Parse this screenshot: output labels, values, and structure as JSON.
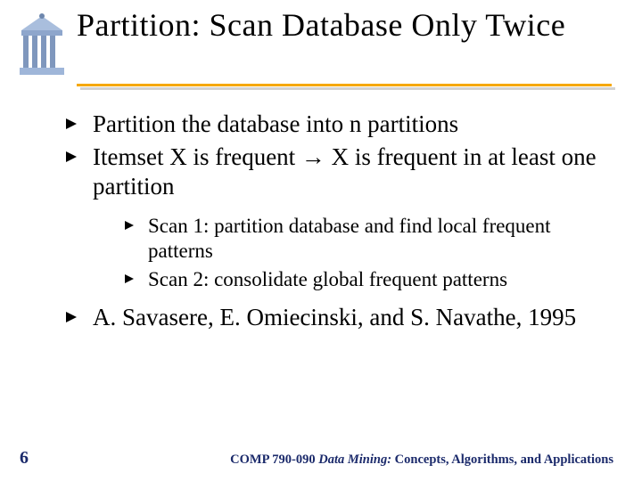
{
  "title": "Partition: Scan Database Only Twice",
  "bullets": {
    "b1": "Partition the database into n partitions",
    "b2": "Itemset X is frequent → X is frequent in at least one partition",
    "s1": "Scan 1: partition database and find local frequent patterns",
    "s2": "Scan 2: consolidate global frequent patterns",
    "b3": "A. Savasere, E. Omiecinski, and S. Navathe, 1995"
  },
  "footer": {
    "page": "6",
    "course_code": "COMP 790-090 ",
    "course_name": "Data Mining:",
    "course_rest": " Concepts, Algorithms, and Applications"
  }
}
